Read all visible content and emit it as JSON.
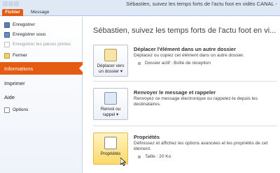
{
  "window": {
    "title": "Sébastien, suivez les temps forts de l'actu foot en vidéo CANAL -"
  },
  "tabs": {
    "fichier": "Fichier",
    "message": "Message"
  },
  "leftnav": {
    "commands": [
      {
        "label": "Enregistrer",
        "icon": "save-icon",
        "enabled": true
      },
      {
        "label": "Enregistrer sous",
        "icon": "save-as-icon",
        "enabled": true
      },
      {
        "label": "Enregistrer les pièces jointes",
        "icon": "attachment-icon",
        "enabled": false
      },
      {
        "label": "Fermer",
        "icon": "close-folder-icon",
        "enabled": true
      }
    ],
    "pages": [
      {
        "label": "Informations",
        "active": true
      },
      {
        "label": "Imprimer",
        "active": false
      },
      {
        "label": "Aide",
        "active": false
      }
    ],
    "options_label": "Options"
  },
  "main": {
    "page_title": "Sébastien, suivez les temps forts de l'actu foot en vi...",
    "sections": [
      {
        "button_line1": "Déplacer vers",
        "button_line2": "un dossier ▾",
        "title": "Déplacer l'élément dans un autre dossier",
        "description": "Déplacez ou copiez cet élément dans un autre dossier.",
        "detail": "Dossier actif :   Boîte de réception"
      },
      {
        "button_line1": "Renvoi ou",
        "button_line2": "rappel ▾",
        "title": "Renvoyer le message et rappeler",
        "description": "Renvoyez ce message électronique ou rappelez-le depuis les destinataires."
      },
      {
        "button_line1": "Propriétés",
        "title": "Propriétés",
        "description": "Définissez et affichez les options avancées et les propriétés de cet élément.",
        "detail": "Taille :    20 Ko"
      }
    ]
  },
  "colors": {
    "accent": "#e35c12",
    "hover": "#fbd96a"
  }
}
